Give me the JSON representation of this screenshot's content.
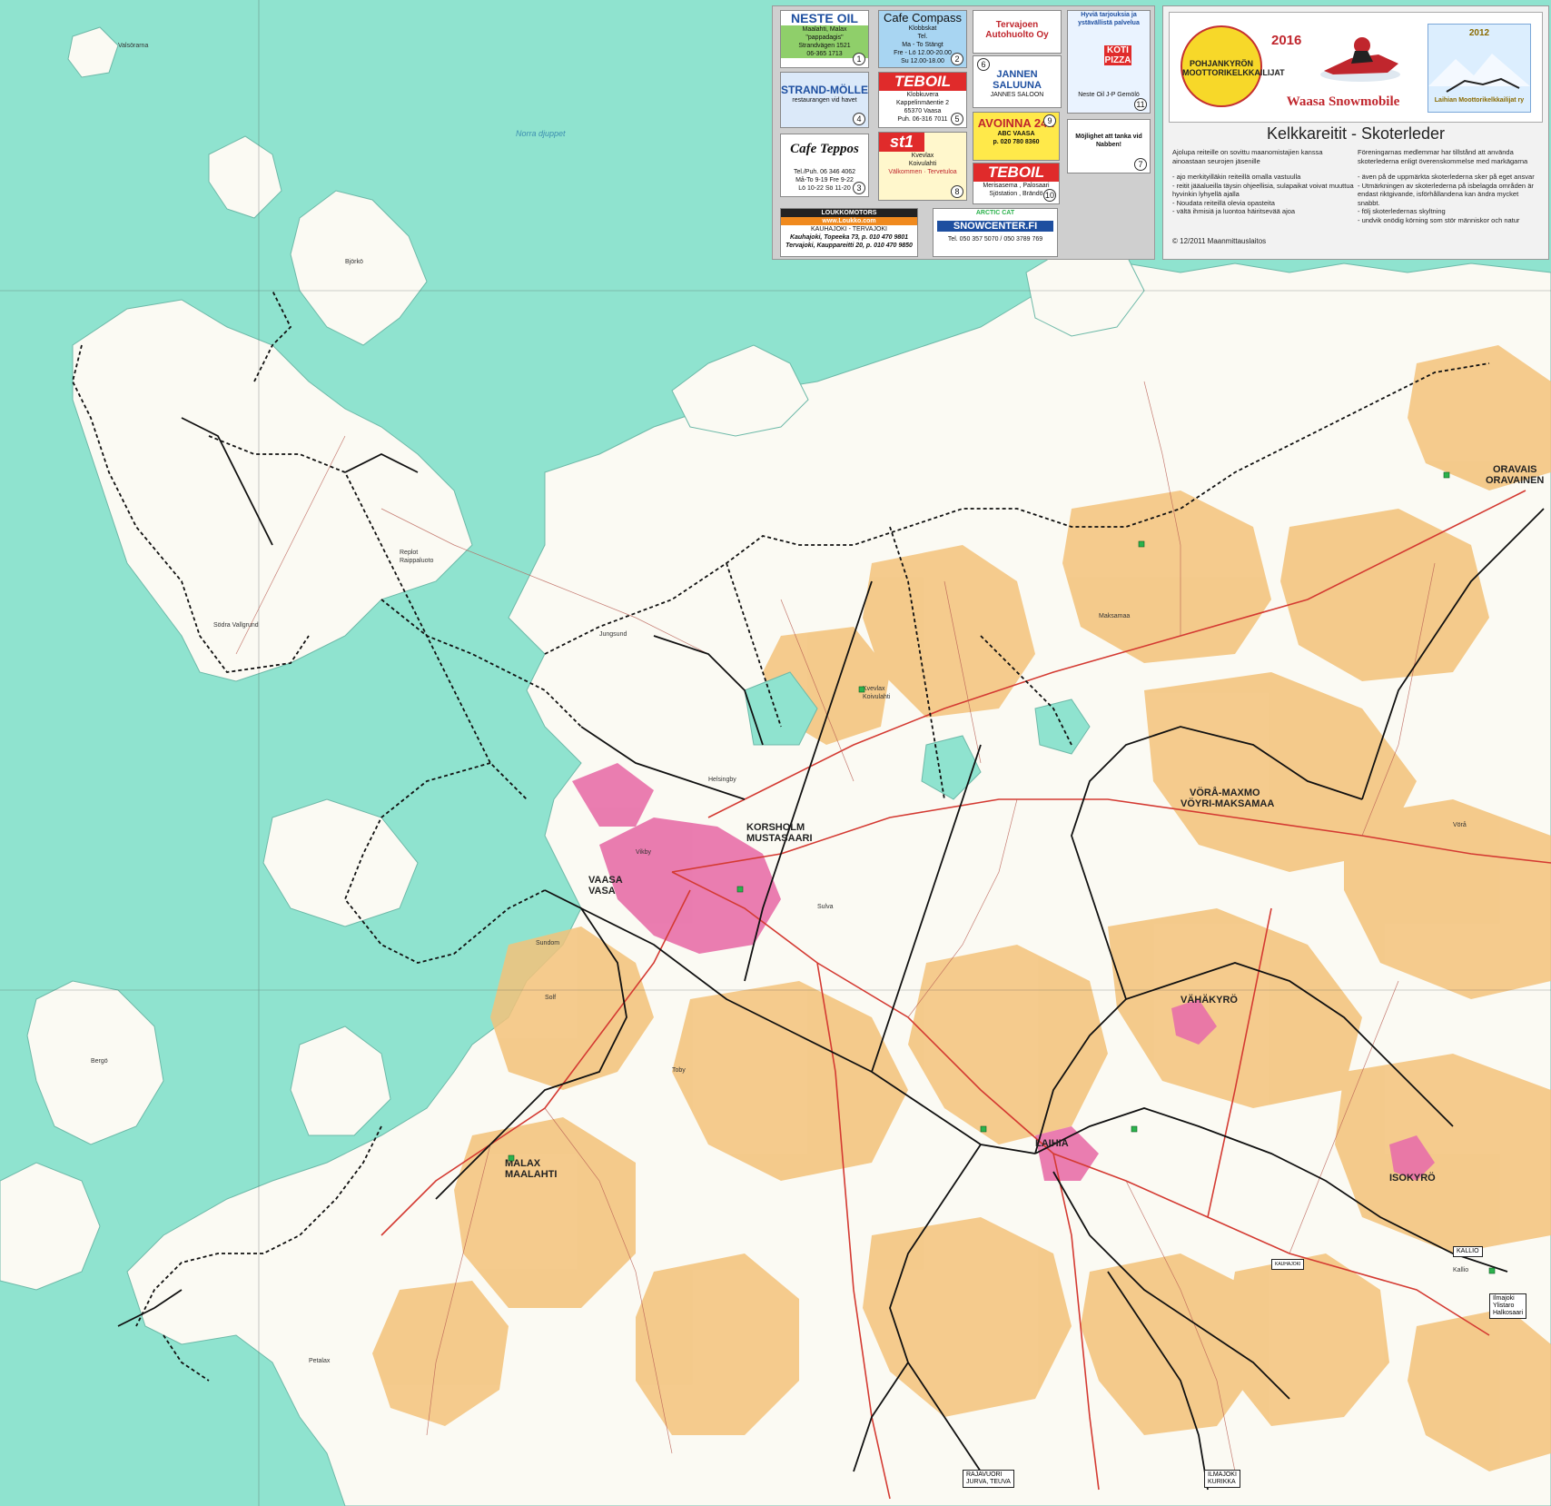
{
  "ads": [
    {
      "brand": "NESTE OIL",
      "lines": [
        "Maalahti, Malax",
        "\"pappadagis\"",
        "Strandvägen 1521",
        "06-365 1713"
      ],
      "num": "1"
    },
    {
      "brand": "Cafe Compass",
      "lines": [
        "Klobbskat",
        "Tel.",
        "Ma - To Stängt",
        "Fre - Lö 12.00-20.00",
        "Su 12.00-18.00"
      ],
      "num": "2"
    },
    {
      "brand": "Cafe Teppos",
      "lines": [
        "Tel./Puh. 06 346 4062",
        "Må-To 9-19 Fre 9-22",
        "Lö 10-22 Sö 11-20"
      ],
      "num": "3"
    },
    {
      "brand": "STRAND-MÖLLE",
      "lines": [
        "restaurangen vid havet"
      ],
      "num": "4"
    },
    {
      "brand": "TEBOIL",
      "lines": [
        "Klobkuvera",
        "Kappelinmäentie 2",
        "65370 Vaasa",
        "Puh. 06-316 7011"
      ],
      "num": "5"
    },
    {
      "brand": "Tervajoen Autohuolto Oy",
      "lines": [],
      "num": ""
    },
    {
      "brand": "JANNEN SALUUNA",
      "lines": [
        "JANNES SALOON"
      ],
      "num": "6"
    },
    {
      "brand": "st1",
      "lines": [
        "Kvevlax",
        "Koivulahti",
        "Välkommen · Tervetuloa"
      ],
      "num": "8"
    },
    {
      "brand": "AVOINNA 24h",
      "lines": [
        "ABC VAASA",
        "p. 020 780 8360"
      ],
      "num": "9"
    },
    {
      "brand": "TEBOIL",
      "lines": [
        "Merisasema , Palosaari",
        "Sjöstation , Brändö"
      ],
      "num": "10"
    },
    {
      "brand": "Hyviä tarjouksia ja ystävällistä palvelua",
      "lines": [
        "KOTI PIZZA",
        "Neste Oil J-P Gemölö"
      ],
      "num": "11"
    },
    {
      "brand": "Möjlighet att tanka vid Nabben!",
      "lines": [],
      "num": "7"
    },
    {
      "brand": "LOUKKOMOTORS",
      "lines": [
        "www.Loukko.com",
        "KAUHAJOKI - TERVAJOKI",
        "Kauhajoki, Topeeka 73, p. 010 470 9801",
        "Tervajoki, Kauppareitti 20, p. 010 470 9850"
      ],
      "num": ""
    },
    {
      "brand": "SNOWCENTER.FI",
      "lines": [
        "ARCTIC CAT",
        "Tel. 050 357 5070 / 050 3789 769"
      ],
      "num": ""
    }
  ],
  "legend": {
    "club_left": "POHJANKYRÖN MOOTTORIKELKKAILIJAT",
    "club_right": "Laihian Moottorikelkkailijat ry",
    "year_left": "2016",
    "year_right": "2012",
    "title_club": "Waasa Snowmobile",
    "title": "Kelkkareitit - Skoterleder",
    "fi_text": [
      "Ajolupa reiteille on sovittu maanomistajien kanssa ainoastaan seurojen jäsenille",
      "- ajo merkityilläkin reiteillä omalla vastuulla",
      "- reitit jääalueilla täysin ohjeellisia, sulapaikat voivat muuttua hyvinkin lyhyellä ajalla",
      "- Noudata reiteillä olevia opasteita",
      "- vältä ihmisiä ja luontoa häiritsevää ajoa"
    ],
    "sv_text": [
      "Föreningarnas medlemmar har tillstånd att använda skoterlederna enligt överenskommelse med markägarna",
      "- även på de uppmärkta skoterlederna sker på eget ansvar",
      "- Utmärkningen av skoterlederna på isbelagda områden är endast riktgivande, isförhållandena kan ändra mycket snabbt.",
      "- följ skoterledernas skyltning",
      "- undvik onödig körning som stör människor och natur"
    ],
    "copyright": "© 12/2011 Maanmittauslaitos"
  },
  "towns": [
    {
      "name": "VAASA",
      "sub": "VASA"
    },
    {
      "name": "KORSHOLM",
      "sub": "MUSTASAARI"
    },
    {
      "name": "MALAX",
      "sub": "MAALAHTI"
    },
    {
      "name": "LAIHIA",
      "sub": ""
    },
    {
      "name": "ISOKYRÖ",
      "sub": ""
    },
    {
      "name": "VÄHÄKYRÖ",
      "sub": ""
    },
    {
      "name": "VÖRÅ-MAXMO",
      "sub": "VÖYRI-MAKSAMAA"
    },
    {
      "name": "ORAVAIS",
      "sub": "ORAVAINEN"
    }
  ],
  "places": [
    "Norra djuppet",
    "Södra Vallgrund",
    "Replot",
    "Raippaluoto",
    "Björkö",
    "Valsörarna",
    "Solf",
    "Sundom",
    "Petalax",
    "Bergö",
    "Kvevlax",
    "Koivulahti",
    "Maksamaa",
    "Vörå",
    "Kallio",
    "Toby",
    "Sulva",
    "Jungsund",
    "Helsingby",
    "Vikby"
  ],
  "exits": {
    "ilmajoki": [
      "Ilmajoki",
      "Ylistaro",
      "Halkosaari"
    ],
    "jurva": [
      "RAJAVUORI",
      "JURVA, TEUVA"
    ],
    "seinajoki": [
      "ILMAJOKI",
      "KURIKKA"
    ],
    "kallio": "KALLIO",
    "kauhajoki": "KAUHAJOKI"
  }
}
